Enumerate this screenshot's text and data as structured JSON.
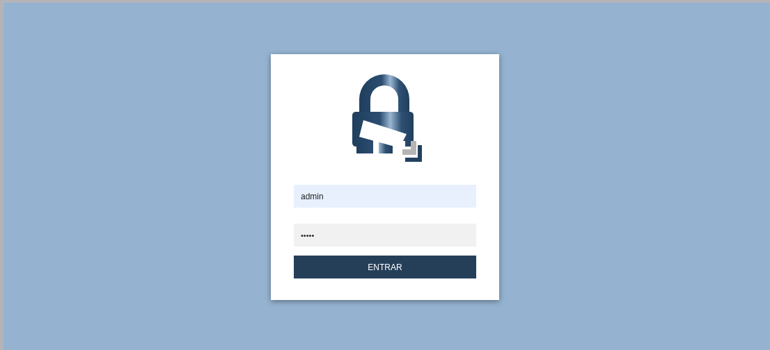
{
  "login": {
    "username": {
      "value": "admin"
    },
    "password": {
      "value": "•••••"
    },
    "button": "ENTRAR"
  }
}
